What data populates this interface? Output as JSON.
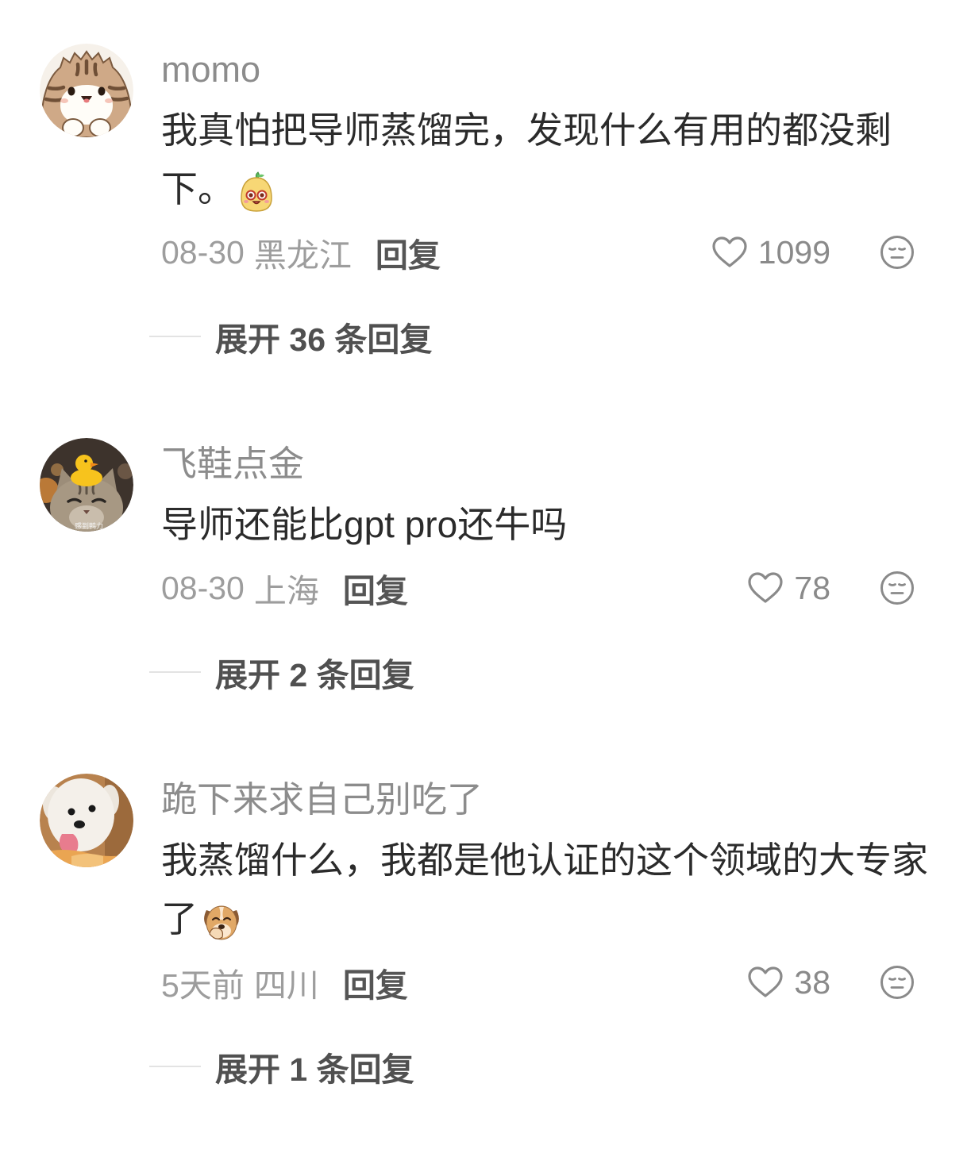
{
  "colors": {
    "background": "#ffffff",
    "username": "#8c8c8c",
    "comment_text": "#2b2b2b",
    "meta_text": "#9d9d9d",
    "action_text": "#555555",
    "icon": "#8a8a8a",
    "divider": "#e3e3e3"
  },
  "icons": {
    "like": "heart-icon",
    "dislike": "dislike-face-icon"
  },
  "comments": [
    {
      "username": "momo",
      "avatar": "tabby-cat-avatar",
      "text": "我真怕把导师蒸馏完，发现什么有用的都没剩下。",
      "sticker": "yellow-face-sticker",
      "date": "08-30",
      "location": "黑龙江",
      "reply_label": "回复",
      "like_count": "1099",
      "expand_label": "展开 36 条回复"
    },
    {
      "username": "飞鞋点金",
      "avatar": "cat-with-duck-avatar",
      "avatar_caption": "感到鸭力",
      "text": "导师还能比gpt pro还牛吗",
      "date": "08-30",
      "location": "上海",
      "reply_label": "回复",
      "like_count": "78",
      "expand_label": "展开 2 条回复"
    },
    {
      "username": "跪下来求自己别吃了",
      "avatar": "white-dog-avatar",
      "text": "我蒸馏什么，我都是他认证的这个领域的大专家了",
      "sticker": "dog-face-sticker",
      "date": "5天前",
      "location": "四川",
      "reply_label": "回复",
      "like_count": "38",
      "expand_label": "展开 1 条回复"
    }
  ]
}
